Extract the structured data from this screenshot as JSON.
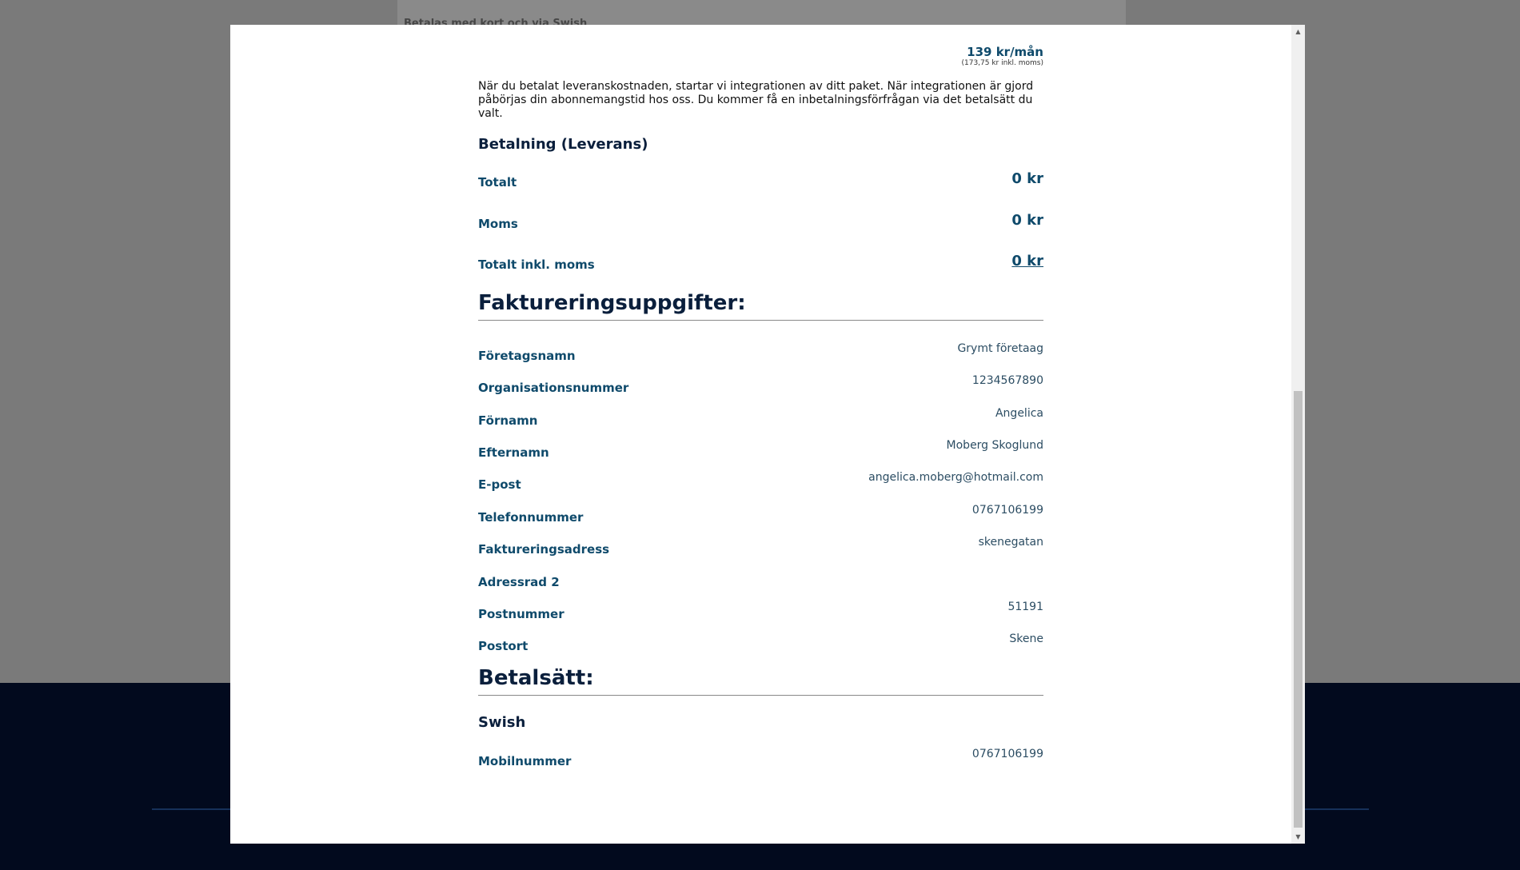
{
  "background": {
    "header_text": "Betalas med kort och via Swish"
  },
  "pricing": {
    "monthly_price": "139 kr/mån",
    "monthly_price_incl_vat": "(173,75 kr inkl. moms)",
    "info_text": "När du betalat leveranskostnaden, startar vi integrationen av ditt paket. När integrationen är gjord påbörjas din abonnemangstid hos oss. Du kommer få en inbetalningsförfrågan via det betalsätt du valt."
  },
  "delivery_payment": {
    "title": "Betalning (Leverans)",
    "rows": [
      {
        "label": "Totalt",
        "value": "0 kr"
      },
      {
        "label": "Moms",
        "value": "0 kr"
      },
      {
        "label": "Totalt inkl. moms",
        "value": "0 kr"
      }
    ]
  },
  "billing": {
    "title": "Faktureringsuppgifter:",
    "fields": [
      {
        "label": "Företagsnamn",
        "value": "Grymt företaag"
      },
      {
        "label": "Organisationsnummer",
        "value": "1234567890"
      },
      {
        "label": "Förnamn",
        "value": "Angelica"
      },
      {
        "label": "Efternamn",
        "value": "Moberg Skoglund"
      },
      {
        "label": "E-post",
        "value": "angelica.moberg@hotmail.com"
      },
      {
        "label": "Telefonnummer",
        "value": "0767106199"
      },
      {
        "label": "Faktureringsadress",
        "value": "skenegatan"
      },
      {
        "label": "Adressrad 2",
        "value": ""
      },
      {
        "label": "Postnummer",
        "value": "51191"
      },
      {
        "label": "Postort",
        "value": "Skene"
      }
    ]
  },
  "payment_method": {
    "title": "Betalsätt:",
    "method": "Swish",
    "mobile_label": "Mobilnummer",
    "mobile_value": "0767106199"
  },
  "scrollbar": {
    "up_glyph": "▲",
    "down_glyph": "▼"
  }
}
